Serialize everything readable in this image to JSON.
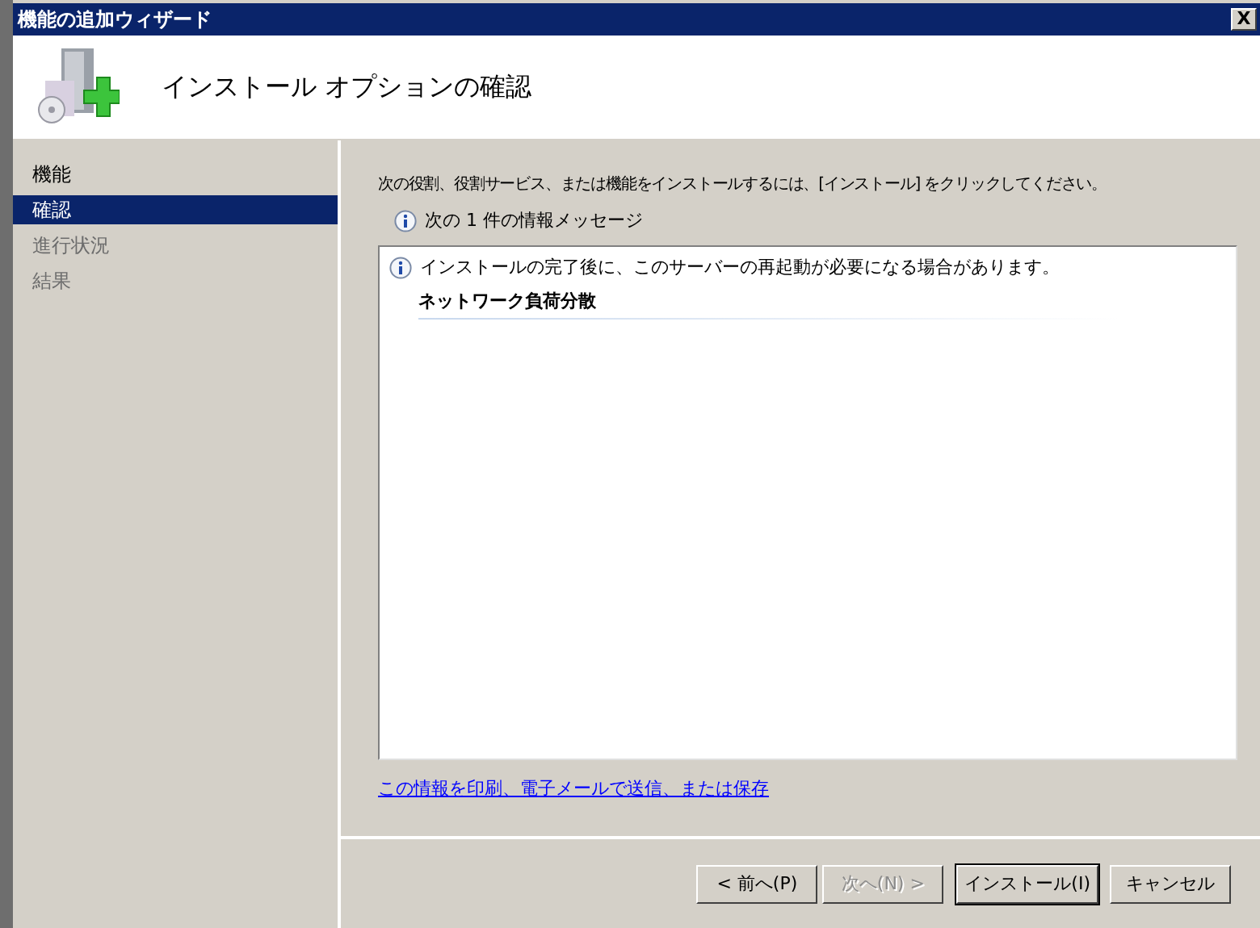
{
  "window": {
    "title": "機能の追加ウィザード",
    "close": "X"
  },
  "header": {
    "title": "インストール オプションの確認"
  },
  "sidebar": {
    "items": [
      {
        "label": "機能",
        "selected": false,
        "disabled": false
      },
      {
        "label": "確認",
        "selected": true,
        "disabled": false
      },
      {
        "label": "進行状況",
        "selected": false,
        "disabled": true
      },
      {
        "label": "結果",
        "selected": false,
        "disabled": true
      }
    ]
  },
  "content": {
    "instruction": "次の役割、役割サービス、または機能をインストールするには、[インストール] をクリックしてください。",
    "info_summary": "次の 1 件の情報メッセージ",
    "messages": [
      {
        "kind": "info",
        "text": "インストールの完了後に、このサーバーの再起動が必要になる場合があります。"
      },
      {
        "kind": "heading",
        "text": "ネットワーク負荷分散"
      }
    ],
    "link": "この情報を印刷、電子メールで送信、または保存"
  },
  "buttons": [
    {
      "label": "< 前へ(P)",
      "disabled": false,
      "default": false
    },
    {
      "label": "次へ(N) >",
      "disabled": true,
      "default": false
    },
    {
      "label": "インストール(I)",
      "disabled": false,
      "default": true
    },
    {
      "label": "キャンセル",
      "disabled": false,
      "default": false
    }
  ]
}
